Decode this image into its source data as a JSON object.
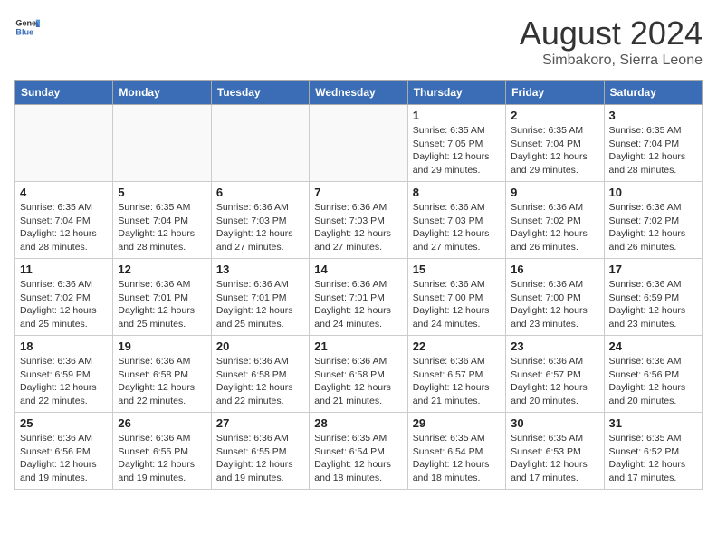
{
  "header": {
    "logo_general": "General",
    "logo_blue": "Blue",
    "title": "August 2024",
    "subtitle": "Simbakoro, Sierra Leone"
  },
  "days_of_week": [
    "Sunday",
    "Monday",
    "Tuesday",
    "Wednesday",
    "Thursday",
    "Friday",
    "Saturday"
  ],
  "weeks": [
    [
      {
        "day": "",
        "info": ""
      },
      {
        "day": "",
        "info": ""
      },
      {
        "day": "",
        "info": ""
      },
      {
        "day": "",
        "info": ""
      },
      {
        "day": "1",
        "info": "Sunrise: 6:35 AM\nSunset: 7:05 PM\nDaylight: 12 hours and 29 minutes."
      },
      {
        "day": "2",
        "info": "Sunrise: 6:35 AM\nSunset: 7:04 PM\nDaylight: 12 hours and 29 minutes."
      },
      {
        "day": "3",
        "info": "Sunrise: 6:35 AM\nSunset: 7:04 PM\nDaylight: 12 hours and 28 minutes."
      }
    ],
    [
      {
        "day": "4",
        "info": "Sunrise: 6:35 AM\nSunset: 7:04 PM\nDaylight: 12 hours and 28 minutes."
      },
      {
        "day": "5",
        "info": "Sunrise: 6:35 AM\nSunset: 7:04 PM\nDaylight: 12 hours and 28 minutes."
      },
      {
        "day": "6",
        "info": "Sunrise: 6:36 AM\nSunset: 7:03 PM\nDaylight: 12 hours and 27 minutes."
      },
      {
        "day": "7",
        "info": "Sunrise: 6:36 AM\nSunset: 7:03 PM\nDaylight: 12 hours and 27 minutes."
      },
      {
        "day": "8",
        "info": "Sunrise: 6:36 AM\nSunset: 7:03 PM\nDaylight: 12 hours and 27 minutes."
      },
      {
        "day": "9",
        "info": "Sunrise: 6:36 AM\nSunset: 7:02 PM\nDaylight: 12 hours and 26 minutes."
      },
      {
        "day": "10",
        "info": "Sunrise: 6:36 AM\nSunset: 7:02 PM\nDaylight: 12 hours and 26 minutes."
      }
    ],
    [
      {
        "day": "11",
        "info": "Sunrise: 6:36 AM\nSunset: 7:02 PM\nDaylight: 12 hours and 25 minutes."
      },
      {
        "day": "12",
        "info": "Sunrise: 6:36 AM\nSunset: 7:01 PM\nDaylight: 12 hours and 25 minutes."
      },
      {
        "day": "13",
        "info": "Sunrise: 6:36 AM\nSunset: 7:01 PM\nDaylight: 12 hours and 25 minutes."
      },
      {
        "day": "14",
        "info": "Sunrise: 6:36 AM\nSunset: 7:01 PM\nDaylight: 12 hours and 24 minutes."
      },
      {
        "day": "15",
        "info": "Sunrise: 6:36 AM\nSunset: 7:00 PM\nDaylight: 12 hours and 24 minutes."
      },
      {
        "day": "16",
        "info": "Sunrise: 6:36 AM\nSunset: 7:00 PM\nDaylight: 12 hours and 23 minutes."
      },
      {
        "day": "17",
        "info": "Sunrise: 6:36 AM\nSunset: 6:59 PM\nDaylight: 12 hours and 23 minutes."
      }
    ],
    [
      {
        "day": "18",
        "info": "Sunrise: 6:36 AM\nSunset: 6:59 PM\nDaylight: 12 hours and 22 minutes."
      },
      {
        "day": "19",
        "info": "Sunrise: 6:36 AM\nSunset: 6:58 PM\nDaylight: 12 hours and 22 minutes."
      },
      {
        "day": "20",
        "info": "Sunrise: 6:36 AM\nSunset: 6:58 PM\nDaylight: 12 hours and 22 minutes."
      },
      {
        "day": "21",
        "info": "Sunrise: 6:36 AM\nSunset: 6:58 PM\nDaylight: 12 hours and 21 minutes."
      },
      {
        "day": "22",
        "info": "Sunrise: 6:36 AM\nSunset: 6:57 PM\nDaylight: 12 hours and 21 minutes."
      },
      {
        "day": "23",
        "info": "Sunrise: 6:36 AM\nSunset: 6:57 PM\nDaylight: 12 hours and 20 minutes."
      },
      {
        "day": "24",
        "info": "Sunrise: 6:36 AM\nSunset: 6:56 PM\nDaylight: 12 hours and 20 minutes."
      }
    ],
    [
      {
        "day": "25",
        "info": "Sunrise: 6:36 AM\nSunset: 6:56 PM\nDaylight: 12 hours and 19 minutes."
      },
      {
        "day": "26",
        "info": "Sunrise: 6:36 AM\nSunset: 6:55 PM\nDaylight: 12 hours and 19 minutes."
      },
      {
        "day": "27",
        "info": "Sunrise: 6:36 AM\nSunset: 6:55 PM\nDaylight: 12 hours and 19 minutes."
      },
      {
        "day": "28",
        "info": "Sunrise: 6:35 AM\nSunset: 6:54 PM\nDaylight: 12 hours and 18 minutes."
      },
      {
        "day": "29",
        "info": "Sunrise: 6:35 AM\nSunset: 6:54 PM\nDaylight: 12 hours and 18 minutes."
      },
      {
        "day": "30",
        "info": "Sunrise: 6:35 AM\nSunset: 6:53 PM\nDaylight: 12 hours and 17 minutes."
      },
      {
        "day": "31",
        "info": "Sunrise: 6:35 AM\nSunset: 6:52 PM\nDaylight: 12 hours and 17 minutes."
      }
    ]
  ]
}
